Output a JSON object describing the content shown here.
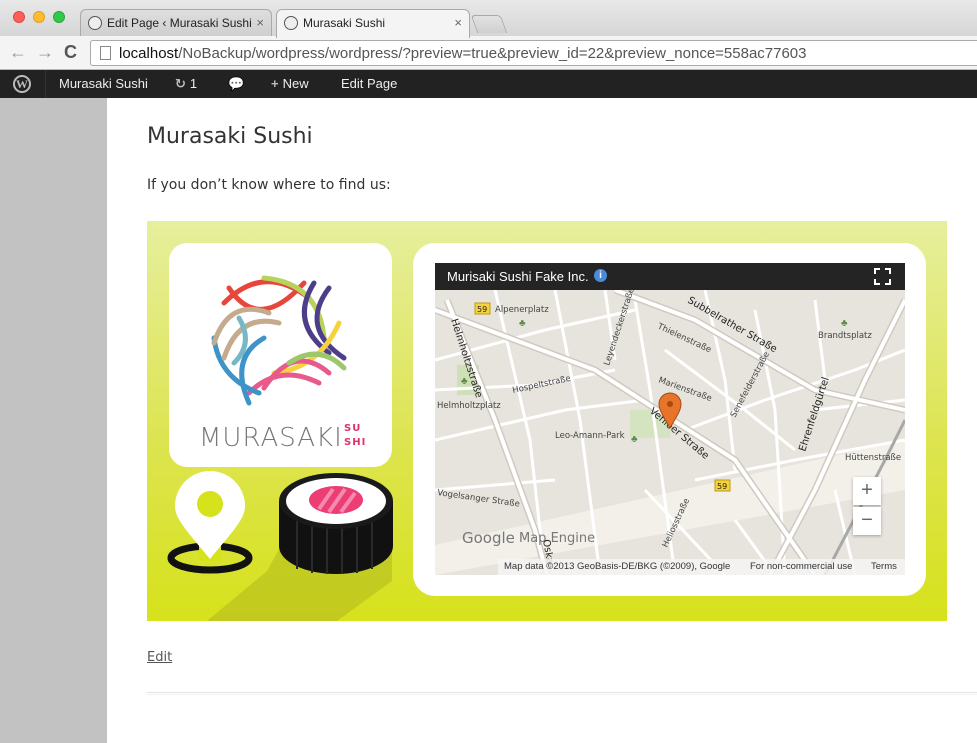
{
  "browser": {
    "tabs": [
      {
        "label": "Edit Page ‹ Murasaki Sushi",
        "active": false
      },
      {
        "label": "Murasaki Sushi",
        "active": true
      }
    ],
    "url_host": "localhost",
    "url_rest": "/NoBackup/wordpress/wordpress/?preview=true&preview_id=22&preview_nonce=558ac77603"
  },
  "adminbar": {
    "site_name": "Murasaki Sushi",
    "updates_count": "1",
    "new_label": "New",
    "edit_label": "Edit Page"
  },
  "page": {
    "title": "Murasaki Sushi",
    "intro": "If you don’t know where to find us:",
    "edit_link": "Edit"
  },
  "logo": {
    "word": "MURASAKI",
    "sub_top": "SU",
    "sub_bottom": "SHI"
  },
  "map": {
    "title": "Murisaki Sushi Fake Inc.",
    "attribution": "Map data ©2013 GeoBasis-DE/BKG (©2009), Google",
    "usage": "For non-commercial use",
    "terms": "Terms",
    "brand": "Google",
    "engine": "Map Engine",
    "streets": [
      "Alpenerplatz",
      "Subbelrather Straße",
      "Helmholtzstraße",
      "Helmholtzplatz",
      "Hospeltstraße",
      "Leo-Amann-Park",
      "Venloer Straße",
      "Ehrenfeldgürtel",
      "Brandtsplatz",
      "Vogelsanger Straße",
      "Marienstraße",
      "Senefelderstraße",
      "Hüttenstraße",
      "Thielenstraße",
      "Leyendeckerstraße",
      "Heliosstraße",
      "Oskar",
      "59",
      "59"
    ]
  },
  "colors": {
    "banner_top": "#e6ef9d",
    "banner_bottom": "#d6e21b",
    "admin_bar": "#222222",
    "marker": "#e8742a"
  }
}
